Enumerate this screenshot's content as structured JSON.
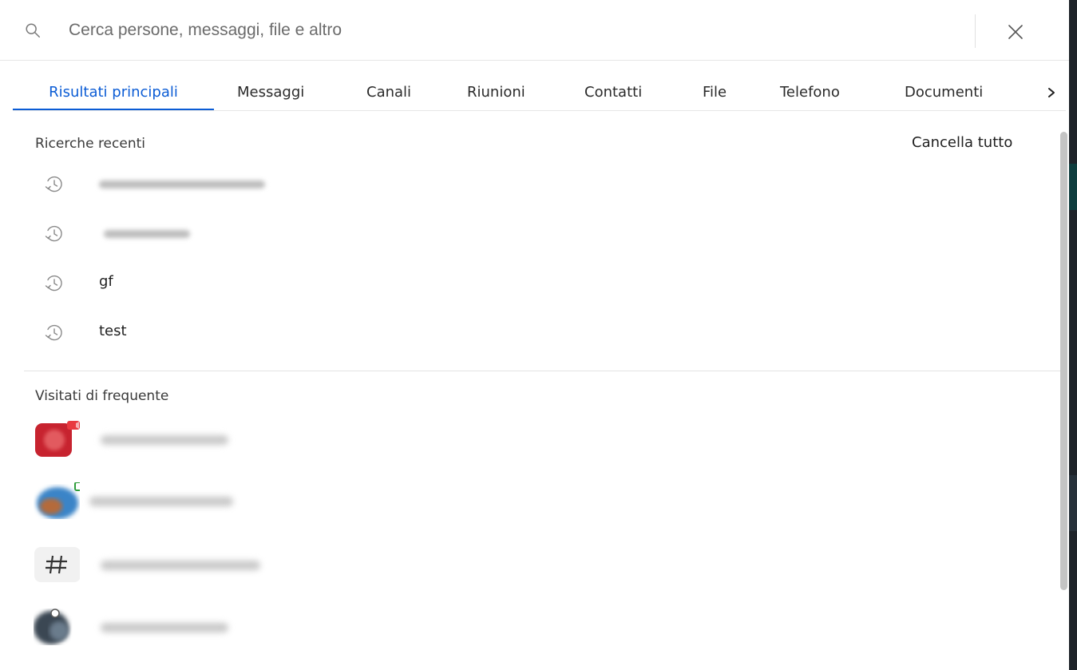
{
  "search": {
    "placeholder": "Cerca persone, messaggi, file e altro",
    "value": ""
  },
  "tabs": [
    {
      "label": "Risultati principali",
      "active": true
    },
    {
      "label": "Messaggi",
      "active": false
    },
    {
      "label": "Canali",
      "active": false
    },
    {
      "label": "Riunioni",
      "active": false
    },
    {
      "label": "Contatti",
      "active": false
    },
    {
      "label": "File",
      "active": false
    },
    {
      "label": "Telefono",
      "active": false
    },
    {
      "label": "Documenti",
      "active": false
    }
  ],
  "tabs_more_icon": "chevron-right-icon",
  "recent": {
    "title": "Ricerche recenti",
    "clear_label": "Cancella tutto",
    "items": [
      {
        "text": "",
        "redacted": true
      },
      {
        "text": "",
        "redacted": true
      },
      {
        "text": "gf",
        "redacted": false
      },
      {
        "text": "test",
        "redacted": false
      }
    ]
  },
  "frequent": {
    "title": "Visitati di frequente",
    "items": [
      {
        "type": "meeting",
        "redacted": true
      },
      {
        "type": "contact",
        "redacted": true
      },
      {
        "type": "channel",
        "icon": "#",
        "redacted": true
      },
      {
        "type": "contact",
        "redacted": true
      }
    ]
  },
  "colors": {
    "accent": "#0b5cd5",
    "meeting_red": "#d12b2b",
    "online_green": "#2e9c3b"
  }
}
